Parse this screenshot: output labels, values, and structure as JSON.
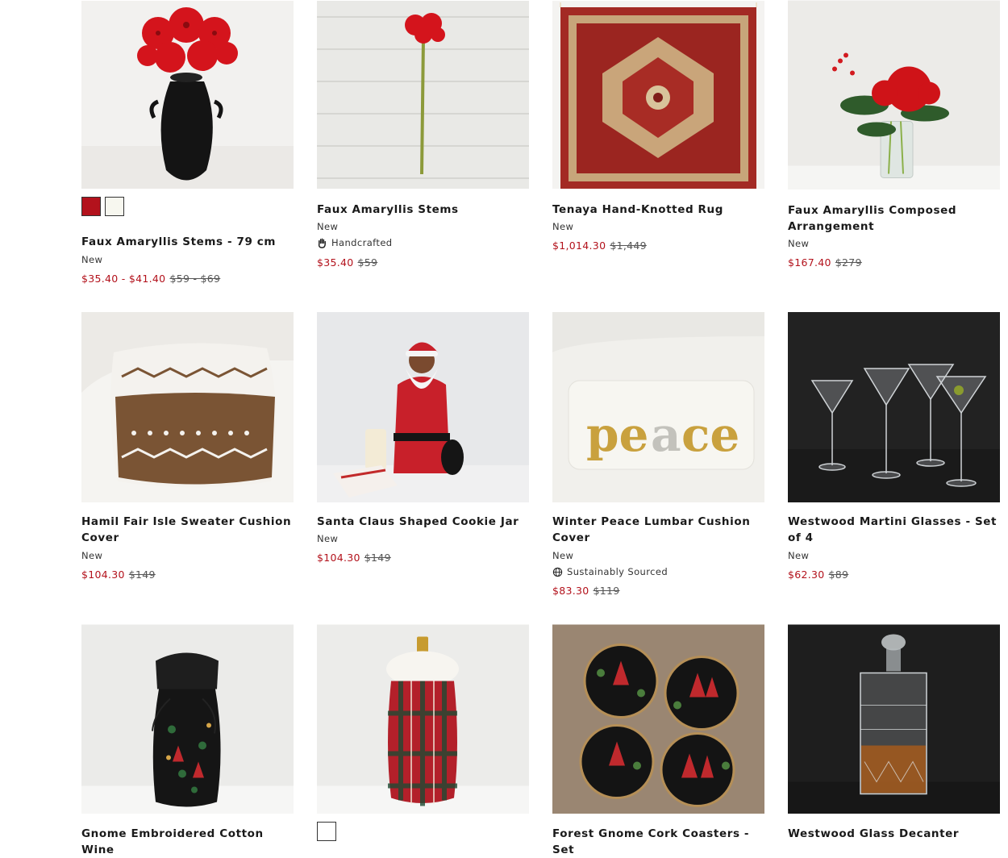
{
  "products": [
    {
      "title": "Faux Amaryllis Stems - 79 cm",
      "tag": "New",
      "badge": "",
      "sale": "$35.40 - $41.40",
      "orig": "$59 - $69",
      "swatches": [
        "#b3121c",
        "#f7f7ef"
      ]
    },
    {
      "title": "Faux Amaryllis Stems",
      "tag": "New",
      "badge": "Handcrafted",
      "badge_icon": "hand-icon",
      "sale": "$35.40",
      "orig": "$59"
    },
    {
      "title": "Tenaya Hand-Knotted Rug",
      "tag": "New",
      "badge": "",
      "sale": "$1,014.30",
      "orig": "$1,449"
    },
    {
      "title": "Faux Amaryllis Composed Arrangement",
      "tag": "New",
      "badge": "",
      "sale": "$167.40",
      "orig": "$279"
    },
    {
      "title": "Hamil Fair Isle Sweater Cushion Cover",
      "tag": "New",
      "badge": "",
      "sale": "$104.30",
      "orig": "$149"
    },
    {
      "title": "Santa Claus Shaped Cookie Jar",
      "tag": "New",
      "badge": "",
      "sale": "$104.30",
      "orig": "$149"
    },
    {
      "title": "Winter Peace Lumbar Cushion Cover",
      "tag": "New",
      "badge": "Sustainably Sourced",
      "badge_icon": "globe-icon",
      "sale": "$83.30",
      "orig": "$119"
    },
    {
      "title": "Westwood Martini Glasses - Set of 4",
      "tag": "New",
      "badge": "",
      "sale": "$62.30",
      "orig": "$89"
    },
    {
      "title": "Gnome Embroidered Cotton Wine",
      "swatches": []
    },
    {
      "title": "",
      "swatches": [
        "#ffffff"
      ]
    },
    {
      "title": "Forest Gnome Cork Coasters - Set"
    },
    {
      "title": "Westwood Glass Decanter"
    }
  ],
  "colors": {
    "sale": "#b3121c",
    "text": "#1a1a1a"
  }
}
